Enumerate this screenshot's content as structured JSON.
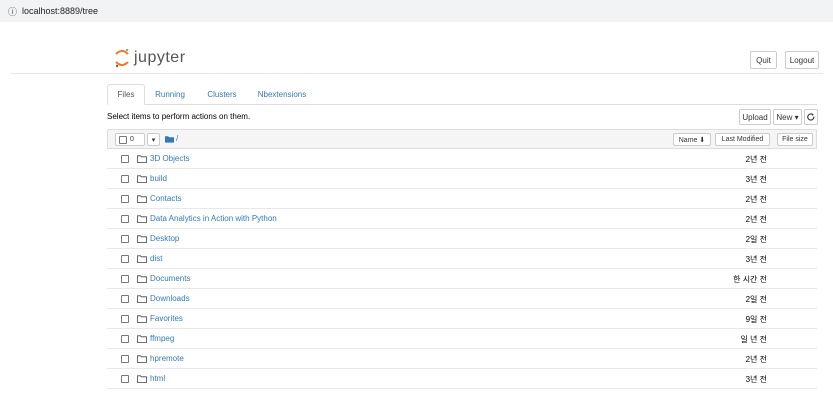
{
  "browser": {
    "info_icon": "ⓘ",
    "url": "localhost:8889/tree"
  },
  "header": {
    "logo_text": "jupyter",
    "quit_label": "Quit",
    "logout_label": "Logout"
  },
  "tabs": [
    {
      "label": "Files",
      "active": true
    },
    {
      "label": "Running",
      "active": false
    },
    {
      "label": "Clusters",
      "active": false
    },
    {
      "label": "Nbextensions",
      "active": false
    }
  ],
  "toolbar": {
    "select_text": "Select items to perform actions on them.",
    "upload_label": "Upload",
    "new_label": "New ▾",
    "refresh_icon": "refresh-icon"
  },
  "list_header": {
    "selected_count": "0",
    "path": "/",
    "name_label": "Name ⬇",
    "last_modified_label": "Last Modified",
    "file_size_label": "File size"
  },
  "rows": [
    {
      "name": "3D Objects",
      "modified": "2년 전"
    },
    {
      "name": "build",
      "modified": "3년 전"
    },
    {
      "name": "Contacts",
      "modified": "2년 전"
    },
    {
      "name": "Data Analytics in Action with Python",
      "modified": "2년 전"
    },
    {
      "name": "Desktop",
      "modified": "2일 전"
    },
    {
      "name": "dist",
      "modified": "3년 전"
    },
    {
      "name": "Documents",
      "modified": "한 시간 전"
    },
    {
      "name": "Downloads",
      "modified": "2일 전"
    },
    {
      "name": "Favorites",
      "modified": "9일 전"
    },
    {
      "name": "ffmpeg",
      "modified": "일 년 전"
    },
    {
      "name": "hpremote",
      "modified": "2년 전"
    },
    {
      "name": "html",
      "modified": "3년 전"
    }
  ],
  "colors": {
    "link": "#337ab7",
    "jupyter_orange": "#f37726"
  }
}
